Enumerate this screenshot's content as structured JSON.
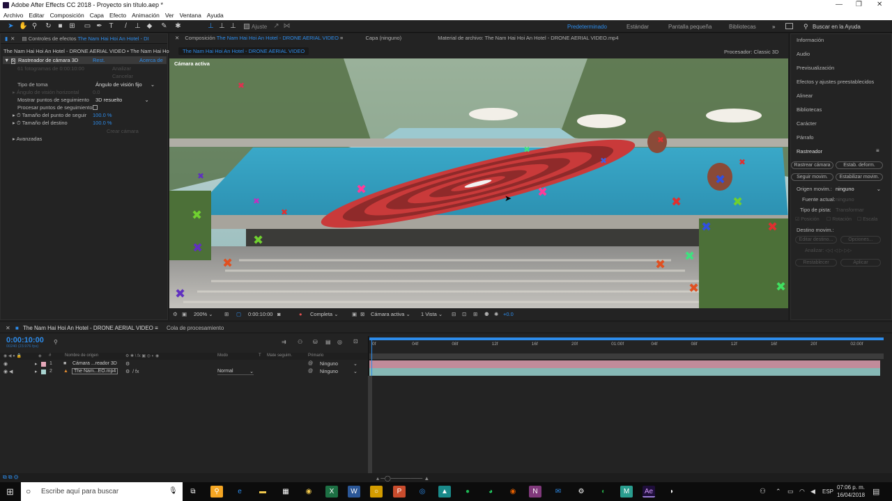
{
  "window": {
    "title": "Adobe After Effects CC 2018 - Proyecto sin título.aep *",
    "minimize": "—",
    "maximize": "❐",
    "close": "✕"
  },
  "menu": [
    "Archivo",
    "Editar",
    "Composición",
    "Capa",
    "Efecto",
    "Animación",
    "Ver",
    "Ventana",
    "Ayuda"
  ],
  "toolbar": {
    "ajuste_label": "Ajuste",
    "workspaces": [
      "Predeterminado",
      "Estándar",
      "Pantalla pequeña",
      "Bibliotecas"
    ],
    "help_search": "Buscar en la Ayuda"
  },
  "effects_panel": {
    "tab": "Controles de efectos",
    "tab_layer": "The Nam Hai Hoi An Hotel - DI",
    "path": "The Nam Hai Hoi An Hotel - DRONE AERIAL VIDEO • The Nam Hai Hoi A",
    "effect_name": "Rastreador de cámara 3D",
    "reset": "Rest.",
    "about": "Acerca de",
    "frames_status": "61 fotogramas de 0:00:10:00",
    "analyze": "Analizar",
    "cancel": "Cancelar",
    "shot_type_label": "Tipo de toma",
    "shot_type_value": "Ángulo de visión fijo",
    "fov_label": "Ángulo de visión horizontal",
    "fov_value": "0.0",
    "show_points_label": "Mostrar puntos de seguimiento",
    "show_points_value": "3D resuelto",
    "render_points_label": "Procesar puntos de seguimiento",
    "point_size_label": "Tamaño del punto de seguir",
    "point_size_value": "100.0 %",
    "target_size_label": "Tamaño del destino",
    "target_size_value": "100.0 %",
    "create_camera": "Crear cámara",
    "advanced": "Avanzadas"
  },
  "comp_panel": {
    "tab_prefix": "Composición",
    "comp_name": "The Nam Hai Hoi An Hotel - DRONE AERIAL VIDEO",
    "layer_tab": "Capa (ninguno)",
    "footage_tab": "Material de archivo: The Nam Hai Hoi An Hotel - DRONE AERIAL VIDEO.mp4",
    "sub_tab": "The Nam Hai Hoi An Hotel - DRONE AERIAL VIDEO",
    "renderer_label": "Procesador:",
    "renderer_value": "Classic 3D",
    "active_camera": "Cámara activa"
  },
  "viewer_bar": {
    "zoom": "200%",
    "time": "0:00:10:00",
    "resolution": "Completa",
    "camera": "Cámara activa",
    "views": "1 Vista",
    "exposure": "+0.0"
  },
  "right_panel": {
    "items": [
      "Información",
      "Audio",
      "Previsualización",
      "Efectos y ajustes preestablecidos",
      "Alinear",
      "Bibliotecas",
      "Carácter",
      "Párrafo"
    ],
    "tracker_title": "Rastreador",
    "btn_track_camera": "Rastrear cámara",
    "btn_warp": "Estab. deform.",
    "btn_track_motion": "Seguir movim.",
    "btn_stabilize": "Estabilizar movim.",
    "origin_label": "Origen movim.:",
    "origin_value": "ninguno",
    "source_label": "Fuente actual:",
    "source_value": "ninguno",
    "track_type_label": "Tipo de pista:",
    "track_type_value": "Transformar",
    "position": "Posición",
    "rotation": "Rotación",
    "scale": "Escala",
    "target_label": "Destino movim.:",
    "edit_target": "Editar destino...",
    "options": "Opciones...",
    "analyze": "Analizar:",
    "reset": "Restablecer",
    "apply": "Aplicar"
  },
  "timeline": {
    "tab": "The Nam Hai Hoi An Hotel - DRONE AERIAL VIDEO",
    "render_queue": "Cola de procesamiento",
    "timecode": "0:00:10:00",
    "fps": "00240 (23.976 fps)",
    "col_source": "Nombre de origen",
    "col_mode": "Modo",
    "col_t": "T",
    "col_matte": "Mate seguim.",
    "col_parent": "Primario",
    "ruler": [
      "0f",
      "04f",
      "08f",
      "12f",
      "16f",
      "20f",
      "01:00f",
      "04f",
      "08f",
      "12f",
      "16f",
      "20f",
      "02:00f"
    ],
    "layers": [
      {
        "num": "1",
        "name": "Cámara ...reador 3D",
        "mode": "",
        "parent": "Ninguno",
        "label_color": "#e5a8b9"
      },
      {
        "num": "2",
        "name": "The Nam...EO.mp4",
        "mode": "Normal",
        "parent": "Ninguno",
        "label_color": "#a9d4d1"
      }
    ]
  },
  "taskbar": {
    "search": "Escribe aquí para buscar",
    "lang": "ESP",
    "time": "07:06 p. m.",
    "date": "16/04/2018"
  }
}
